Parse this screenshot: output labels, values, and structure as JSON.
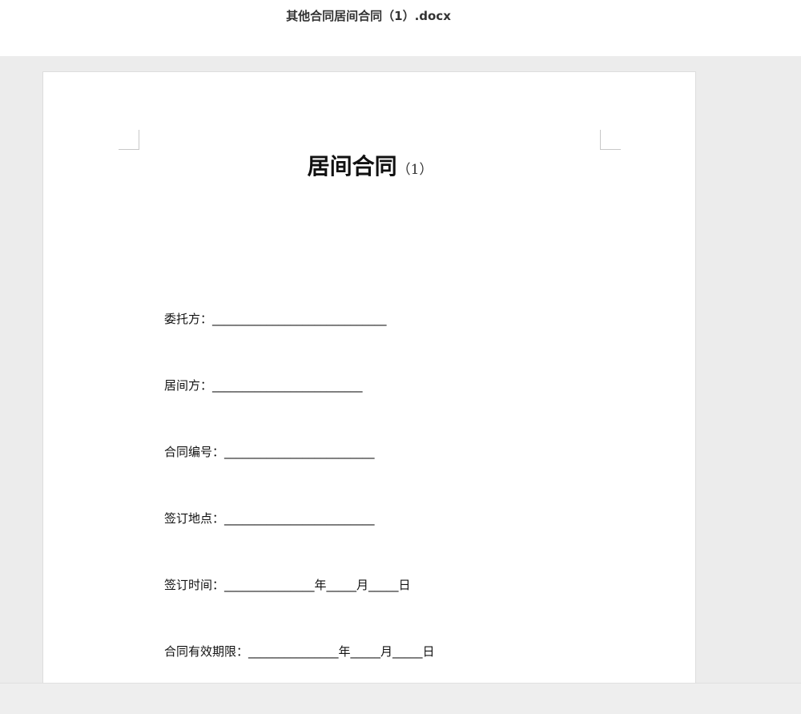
{
  "window": {
    "filename": "其他合同居间合同（1）.docx"
  },
  "document": {
    "title": "居间合同",
    "title_suffix": "（1）",
    "fields": [
      "委托方：_____________________________",
      "居间方：_________________________",
      "合同编号：_________________________",
      "签订地点：_________________________",
      "签订时间：_______________年_____月_____日",
      "合同有效期限：_______________年_____月_____日"
    ]
  }
}
